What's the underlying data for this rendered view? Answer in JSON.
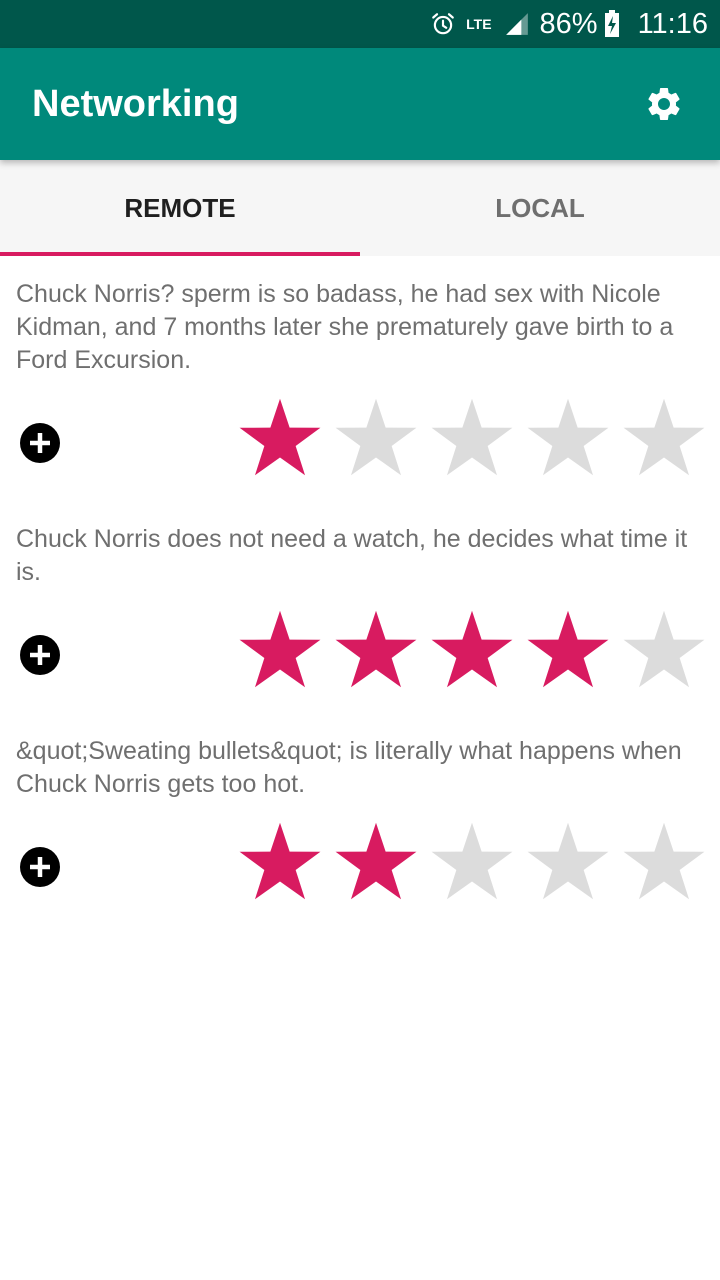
{
  "status_bar": {
    "network": "LTE",
    "battery": "86%",
    "time": "11:16",
    "icons": [
      "alarm-icon",
      "lte-icon",
      "signal-icon",
      "battery-charging-icon"
    ]
  },
  "app_bar": {
    "title": "Networking",
    "settings_icon": "gear-icon"
  },
  "tabs": [
    {
      "label": "REMOTE",
      "active": true
    },
    {
      "label": "LOCAL",
      "active": false
    }
  ],
  "colors": {
    "status_bar": "#00574b",
    "app_bar": "#00897b",
    "accent": "#d81b60",
    "star_empty": "#dcdcdc",
    "body_text": "#6f6f6f"
  },
  "jokes": [
    {
      "text": "Chuck Norris? sperm is so badass, he had sex with Nicole Kidman, and 7 months later she prematurely gave birth to a Ford Excursion.",
      "rating": 1,
      "max_rating": 5
    },
    {
      "text": "Chuck Norris does not need a watch, he decides what time it is.",
      "rating": 4,
      "max_rating": 5
    },
    {
      "text": "&quot;Sweating bullets&quot; is literally what happens when Chuck Norris gets too hot.",
      "rating": 2,
      "max_rating": 5
    }
  ]
}
